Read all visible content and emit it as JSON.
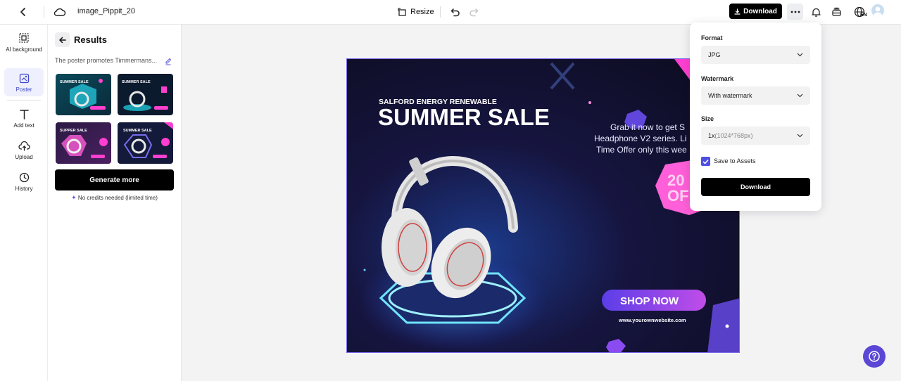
{
  "topbar": {
    "filename": "image_Pippit_20",
    "resize_label": "Resize",
    "download_label": "Download",
    "language_code": "EN"
  },
  "leftnav": {
    "items": [
      {
        "label": "AI background",
        "icon": "ai-background-icon"
      },
      {
        "label": "Poster",
        "icon": "poster-icon",
        "active": true
      },
      {
        "label": "Add text",
        "icon": "text-icon"
      },
      {
        "label": "Upload",
        "icon": "upload-icon"
      },
      {
        "label": "History",
        "icon": "history-icon"
      }
    ]
  },
  "results": {
    "title": "Results",
    "prompt": "The poster promotes Timmermans...",
    "generate_more_label": "Generate more",
    "credits_note": "No credits needed (limited time)",
    "thumbnails": [
      {
        "title": "SUMMER SALE"
      },
      {
        "title": "SUMMER SALE"
      },
      {
        "title": "SUPPER SALE"
      },
      {
        "title": "SUMMER SALE"
      }
    ]
  },
  "poster": {
    "brand": "SALFORD ENERGY RENEWABLE",
    "headline": "SUMMER SALE",
    "offer_line1": "Grab it now to get S",
    "offer_line2": "Headphone V2 series. Li",
    "offer_line3": "Time Offer only this wee",
    "discount_line1": "20",
    "discount_line2": "OF",
    "cta": "SHOP NOW",
    "website": "www.yourownwebsite.com"
  },
  "download_panel": {
    "format_label": "Format",
    "format_value": "JPG",
    "watermark_label": "Watermark",
    "watermark_value": "With watermark",
    "size_label": "Size",
    "size_value": "1x",
    "size_detail": "(1024*768px)",
    "save_to_assets_label": "Save to Assets",
    "save_to_assets_checked": true,
    "download_label": "Download"
  },
  "colors": {
    "accent": "#4e4fe0",
    "poster_bg": "#1a1740",
    "poster_pink": "#ff3fd0",
    "cta_purple": "#7a4cf0"
  }
}
